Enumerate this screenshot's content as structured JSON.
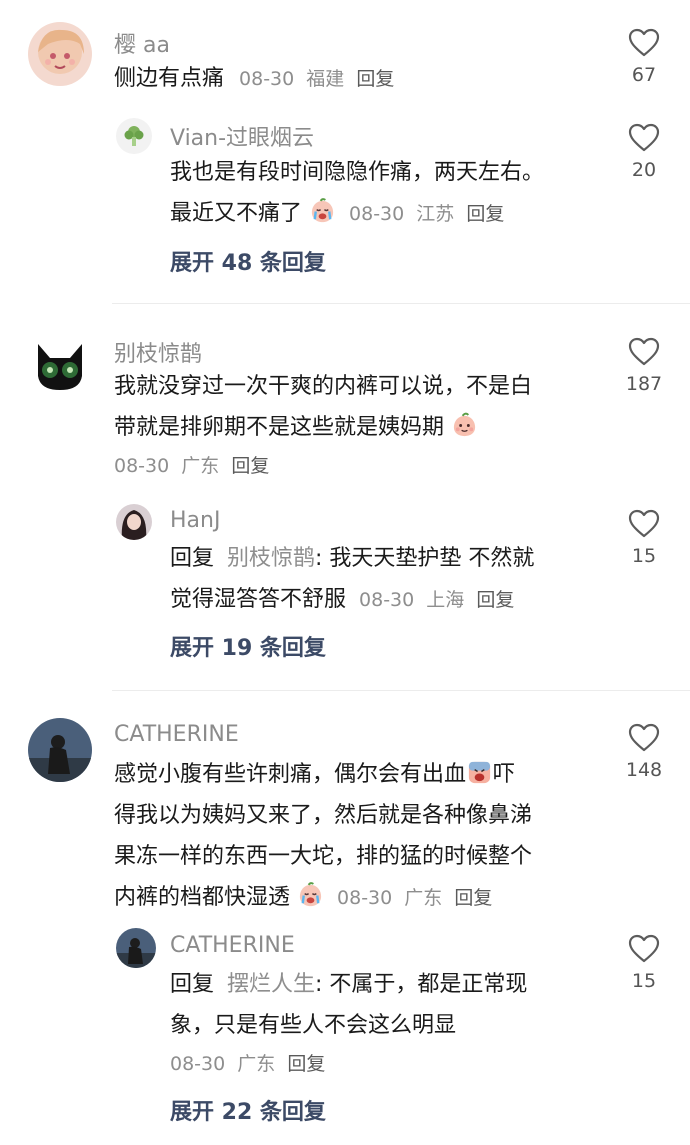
{
  "comments": [
    {
      "author": "樱 aa",
      "text": "侧边有点痛",
      "date": "08-30",
      "location": "福建",
      "reply_label": "回复",
      "likes": "67",
      "reply": {
        "author": "Vian-过眼烟云",
        "text_line1": "我也是有段时间隐隐作痛，两天左右。",
        "text_line2": "最近又不痛了",
        "emoji": "crying-face",
        "date": "08-30",
        "location": "江苏",
        "reply_label": "回复",
        "likes": "20"
      },
      "expand": "展开 48 条回复"
    },
    {
      "author": "别枝惊鹊",
      "text_line1": "我就没穿过一次干爽的内裤可以说，不是白",
      "text_line2": "带就是排卵期不是这些就是姨妈期",
      "emoji": "peach-face",
      "date": "08-30",
      "location": "广东",
      "reply_label": "回复",
      "likes": "187",
      "reply": {
        "author": "HanJ",
        "reply_prefix": "回复",
        "mention": "别枝惊鹊",
        "text_line1": ": 我天天垫护垫 不然就",
        "text_line2": "觉得湿答答不舒服",
        "date": "08-30",
        "location": "上海",
        "reply_label": "回复",
        "likes": "15"
      },
      "expand": "展开 19 条回复"
    },
    {
      "author": "CATHERINE",
      "text_line1": "感觉小腹有些许刺痛，偶尔会有出血",
      "text_line1b": "吓",
      "text_line2": "得我以为姨妈又来了，然后就是各种像鼻涕",
      "text_line3": "果冻一样的东西一大坨，排的猛的时候整个",
      "text_line4": "内裤的档都快湿透",
      "emoji1": "screaming-face",
      "emoji2": "crying-face",
      "date": "08-30",
      "location": "广东",
      "reply_label": "回复",
      "likes": "148",
      "reply": {
        "author": "CATHERINE",
        "reply_prefix": "回复",
        "mention": "摆烂人生",
        "text_line1": ": 不属于，都是正常现",
        "text_line2": "象，只是有些人不会这么明显",
        "date": "08-30",
        "location": "广东",
        "reply_label": "回复",
        "likes": "15"
      },
      "expand": "展开 22 条回复"
    }
  ]
}
